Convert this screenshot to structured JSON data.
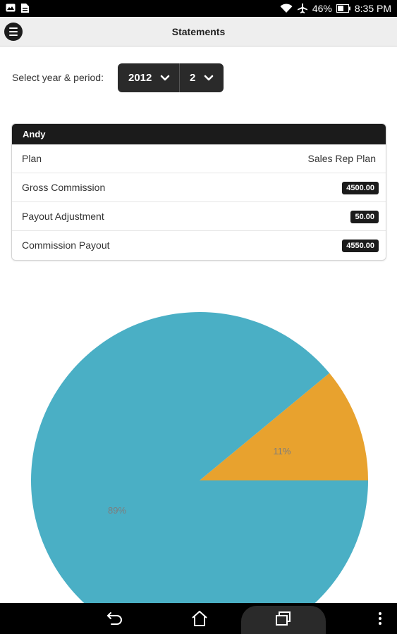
{
  "status_bar": {
    "battery": "46%",
    "time": "8:35 PM"
  },
  "header": {
    "title": "Statements"
  },
  "selector": {
    "label": "Select year & period:",
    "year": "2012",
    "period": "2"
  },
  "card": {
    "name": "Andy",
    "rows": [
      {
        "label": "Plan",
        "value": "Sales Rep Plan"
      },
      {
        "label": "Gross Commission",
        "value": "4500.00"
      },
      {
        "label": "Payout Adjustment",
        "value": "50.00"
      },
      {
        "label": "Commission Payout",
        "value": "4550.00"
      }
    ]
  },
  "chart_data": {
    "type": "pie",
    "slices": [
      {
        "label": "11%",
        "value": 11,
        "color": "#e8a22e"
      },
      {
        "label": "89%",
        "value": 89,
        "color": "#4aafc5"
      }
    ]
  },
  "icons": {
    "menu": "menu-icon",
    "back": "back-icon",
    "home": "home-icon",
    "recents": "recents-icon",
    "overflow": "overflow-menu-icon"
  }
}
